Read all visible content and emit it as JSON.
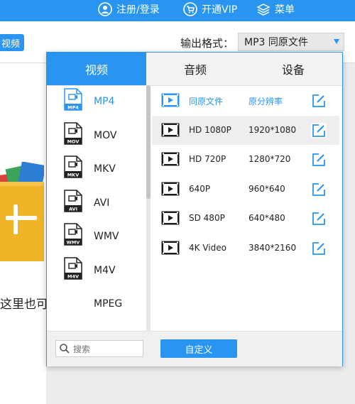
{
  "topbar": {
    "login_label": "注册/登录",
    "vip_label": "开通VIP",
    "menu_label": "菜单",
    "color": "#2a95f1"
  },
  "toolbar": {
    "video_button_label": "视频",
    "output_format_label": "输出格式：",
    "output_format_value": "MP3  同原文件"
  },
  "drop_area": {
    "hint_text": "这里也可"
  },
  "dialog": {
    "tabs": [
      {
        "label": "视频",
        "active": true
      },
      {
        "label": "音频",
        "active": false
      },
      {
        "label": "设备",
        "active": false
      }
    ],
    "formats": [
      {
        "name": "MP4",
        "badge": "MP4",
        "active": true
      },
      {
        "name": "MOV",
        "badge": "MOV",
        "active": false
      },
      {
        "name": "MKV",
        "badge": "MKV",
        "active": false
      },
      {
        "name": "AVI",
        "badge": "AVI",
        "active": false
      },
      {
        "name": "WMV",
        "badge": "WMV",
        "active": false
      },
      {
        "name": "M4V",
        "badge": "M4V",
        "active": false
      },
      {
        "name": "MPEG",
        "badge": "",
        "active": false
      }
    ],
    "presets": [
      {
        "name": "同原文件",
        "resolution": "原分辨率"
      },
      {
        "name": "HD 1080P",
        "resolution": "1920*1080"
      },
      {
        "name": "HD 720P",
        "resolution": "1280*720"
      },
      {
        "name": "640P",
        "resolution": "960*640"
      },
      {
        "name": "SD 480P",
        "resolution": "640*480"
      },
      {
        "name": "4K Video",
        "resolution": "3840*2160"
      }
    ],
    "search_placeholder": "搜索",
    "custom_button_label": "自定义"
  },
  "icons": {
    "user": "user-icon",
    "vip": "cart-icon",
    "menu": "layers-icon",
    "format": "file-video-icon",
    "preset": "film-icon",
    "edit": "edit-icon",
    "search": "search-icon"
  }
}
